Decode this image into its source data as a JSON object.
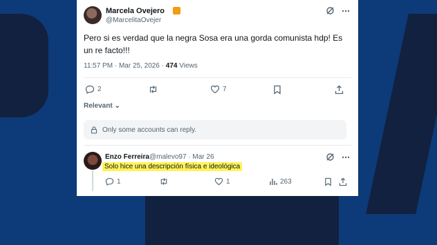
{
  "tweet": {
    "author_name": "Marcela Ovejero",
    "author_handle": "@MarcelitaOvejer",
    "text": "Pero si es verdad que la negra Sosa era una gorda comunista hdp! Es un re facto!!!",
    "time": "11:57 PM · Mar 25, 2026 ·",
    "views_count": "474",
    "views_label": "Views",
    "replies": "2",
    "likes": "7",
    "relevant_label": "Relevant",
    "notice": "Only some accounts can reply."
  },
  "reply": {
    "author_name": "Enzo Ferreira",
    "author_handle": "@malevo97 · Mar 26",
    "text": "Solo hice una descripción física e ideológica",
    "replies": "1",
    "likes": "1",
    "views": "263"
  },
  "icons": [
    "avatar",
    "verified-badge-icon",
    "grok-icon",
    "more-icon",
    "reply-icon",
    "retweet-icon",
    "like-icon",
    "bookmark-icon",
    "share-icon",
    "chevron-down-icon",
    "lock-icon",
    "views-icon"
  ],
  "colors": {
    "background": "#0d3a78",
    "highlight": "#fff35a",
    "verified": "#f29c11"
  }
}
